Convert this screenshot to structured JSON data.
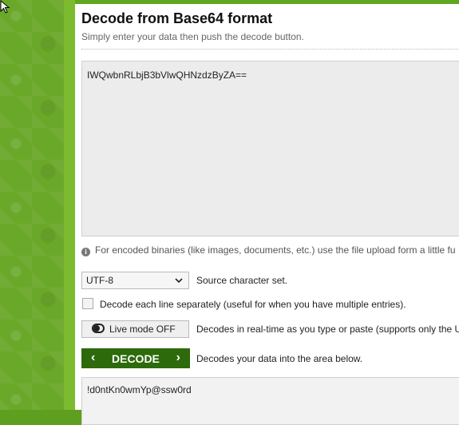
{
  "page": {
    "title": "Decode from Base64 format",
    "subtitle": "Simply enter your data then push the decode button."
  },
  "input": {
    "value": "IWQwbnRLbjB3bVlwQHNzdzByZA=="
  },
  "info": {
    "text": "For encoded binaries (like images, documents, etc.) use the file upload form a little fu",
    "icon": "info-icon"
  },
  "options": {
    "charset_value": "UTF-8",
    "charset_label": "Source character set.",
    "each_line_label": "Decode each line separately (useful for when you have multiple entries).",
    "each_line_checked": false,
    "live_mode_label": "Live mode OFF",
    "live_mode_desc": "Decodes in real-time as you type or paste (supports only the U"
  },
  "decode": {
    "button_label": "DECODE",
    "desc": "Decodes your data into the area below."
  },
  "output": {
    "value": "!d0ntKn0wmYp@ssw0rd"
  },
  "colors": {
    "brand_green": "#5fa71f",
    "button_green": "#2c6a0b"
  }
}
